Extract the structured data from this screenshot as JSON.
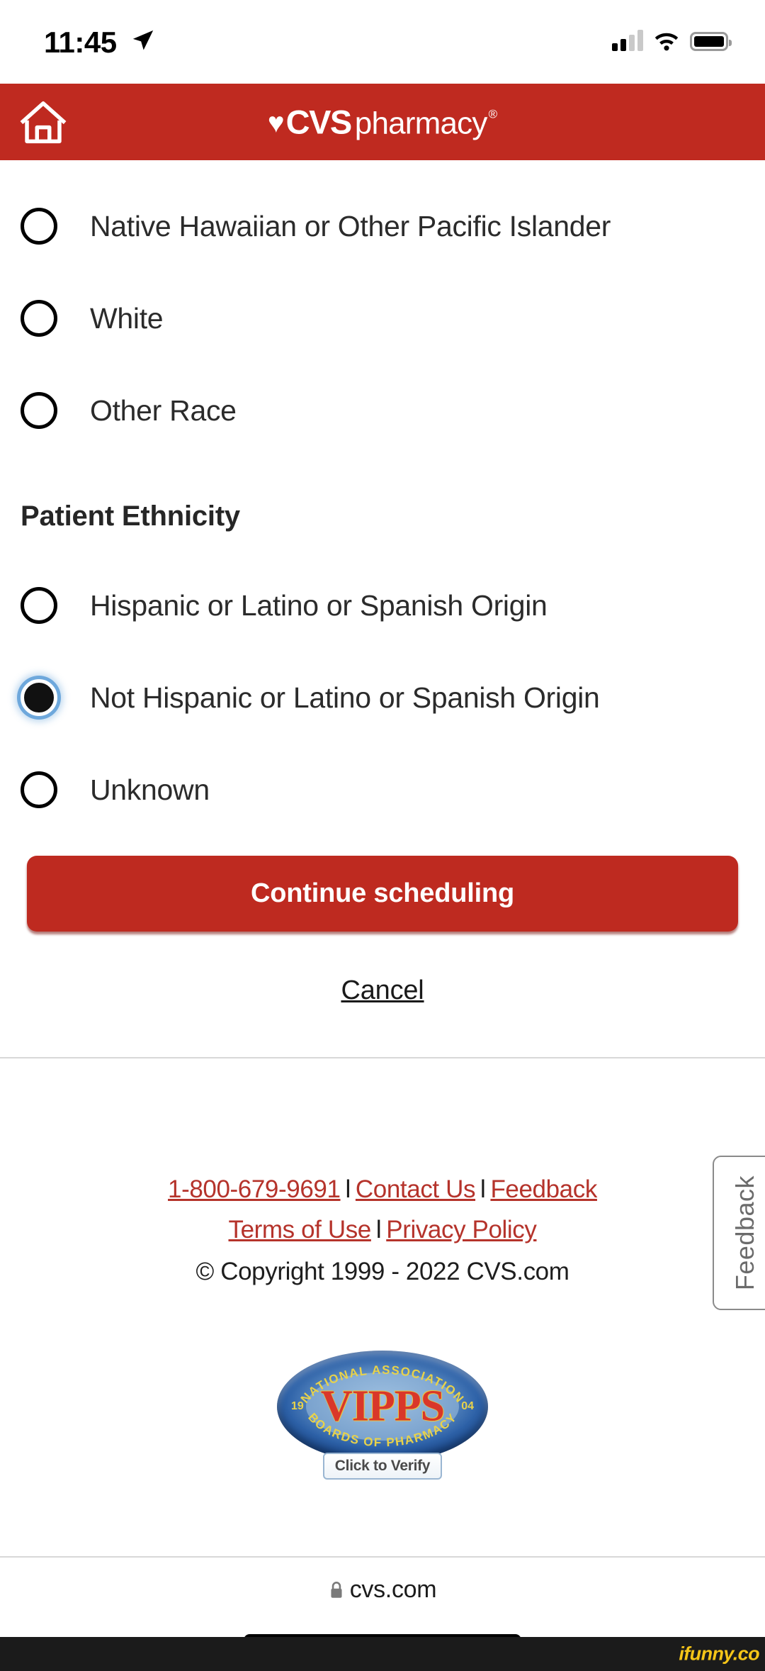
{
  "status_bar": {
    "time": "11:45",
    "location_icon": "location-arrow-icon",
    "signal_icon": "cellular-signal-icon",
    "wifi_icon": "wifi-icon",
    "battery_icon": "battery-icon"
  },
  "header": {
    "home_icon": "home-icon",
    "brand_heart": "♥",
    "brand_main": "CVS",
    "brand_sub": "pharmacy",
    "brand_registered": "®"
  },
  "form": {
    "race_options": [
      {
        "label": "Native Hawaiian or Other Pacific Islander",
        "selected": false
      },
      {
        "label": "White",
        "selected": false
      },
      {
        "label": "Other Race",
        "selected": false
      }
    ],
    "ethnicity_title": "Patient Ethnicity",
    "ethnicity_options": [
      {
        "label": "Hispanic or Latino or Spanish Origin",
        "selected": false
      },
      {
        "label": "Not Hispanic or Latino or Spanish Origin",
        "selected": true
      },
      {
        "label": "Unknown",
        "selected": false
      }
    ],
    "continue_label": "Continue scheduling",
    "cancel_label": "Cancel"
  },
  "footer": {
    "phone": "1-800-679-9691",
    "contact_us": "Contact Us",
    "feedback": "Feedback",
    "terms_of_use": "Terms of Use",
    "privacy_policy": "Privacy Policy",
    "separator": "l",
    "copyright": "© Copyright 1999 - 2022 CVS.com",
    "feedback_tab": "Feedback"
  },
  "vipps": {
    "arc_top": "NATIONAL ASSOCIATION",
    "arc_bottom": "BOARDS OF PHARMACY",
    "center": "VIPPS",
    "year_left": "19",
    "year_right": "04",
    "registered": "®",
    "verify": "Click to Verify"
  },
  "browser": {
    "lock_icon": "lock-icon",
    "url": "cvs.com"
  },
  "watermark": {
    "text": "ifunny.co"
  },
  "colors": {
    "cvs_red": "#bf2a20",
    "button_red": "#be2a20",
    "link_red": "#b5332b",
    "focus_blue": "#6ea8dc",
    "watermark_yellow": "#f5c518"
  }
}
